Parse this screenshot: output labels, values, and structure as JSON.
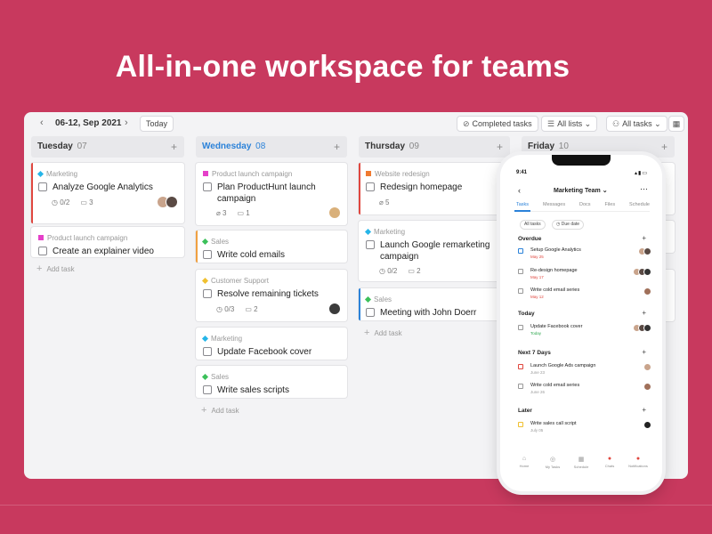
{
  "headline": "All-in-one workspace for teams",
  "toolbar": {
    "date_range": "06-12, Sep 2021",
    "today": "Today",
    "completed": "Completed tasks",
    "all_lists": "All lists",
    "all_tasks": "All tasks"
  },
  "columns": [
    {
      "day": "Tuesday",
      "num": "07",
      "cards": [
        {
          "tag": "Marketing",
          "title": "Analyze Google Analytics",
          "checks": "0/2",
          "comments": "3"
        },
        {
          "tag": "Product launch campaign",
          "title": "Create an explainer video"
        }
      ],
      "add": "Add task"
    },
    {
      "day": "Wednesday",
      "num": "08",
      "cards": [
        {
          "tag": "Product launch campaign",
          "title1": "Plan ProductHunt launch",
          "title2": "campaign",
          "attach": "3",
          "comments": "1"
        },
        {
          "tag": "Sales",
          "title": "Write cold emails"
        },
        {
          "tag": "Customer Support",
          "title": "Resolve remaining tickets",
          "checks": "0/3",
          "comments": "2"
        },
        {
          "tag": "Marketing",
          "title": "Update Facebook cover"
        },
        {
          "tag": "Sales",
          "title": "Write sales scripts"
        }
      ],
      "add": "Add task"
    },
    {
      "day": "Thursday",
      "num": "09",
      "cards": [
        {
          "tag": "Website redesign",
          "title": "Redesign homepage",
          "attach": "5"
        },
        {
          "tag": "Marketing",
          "title1": "Launch Google remarketing",
          "title2": "campaign",
          "checks": "0/2",
          "comments": "2"
        },
        {
          "tag": "Sales",
          "title": "Meeting with John Doerr"
        }
      ],
      "add": "Add task"
    },
    {
      "day": "Friday",
      "num": "10"
    }
  ],
  "phone": {
    "time": "9:41",
    "title": "Marketing Team",
    "tabs": [
      "Tasks",
      "Messages",
      "Docs",
      "Files",
      "Schedule"
    ],
    "filters": [
      "All tasks",
      "Due date"
    ],
    "sections": {
      "overdue": "Overdue",
      "today": "Today",
      "next7": "Next 7 Days",
      "later": "Later"
    },
    "tasks": {
      "t1": {
        "title": "Setup Google Analytics",
        "date": "May 25"
      },
      "t2": {
        "title": "Re-design homepage",
        "date": "May 17"
      },
      "t3": {
        "title": "Write cold email series",
        "date": "May 12"
      },
      "t4": {
        "title": "Update Facebook cover",
        "date": "Today"
      },
      "t5": {
        "title": "Launch Google Ads campaign",
        "date": "June 23"
      },
      "t6": {
        "title": "Write cold email series",
        "date": "June 26"
      },
      "t7": {
        "title": "Write sales call script",
        "date": "July 05"
      }
    },
    "nav": [
      "Home",
      "My Tasks",
      "Schedule",
      "Chats",
      "Notifications"
    ]
  },
  "colors": {
    "background": "#c8395e",
    "marketing": "#26b5e8",
    "product_launch": "#e540c9",
    "sales": "#3cc05a",
    "support": "#f0c030",
    "website": "#f07a30",
    "bar_red": "#e0473f",
    "bar_orange": "#f0a040",
    "bar_blue": "#2b82d9",
    "accent": "#2b82d9"
  }
}
